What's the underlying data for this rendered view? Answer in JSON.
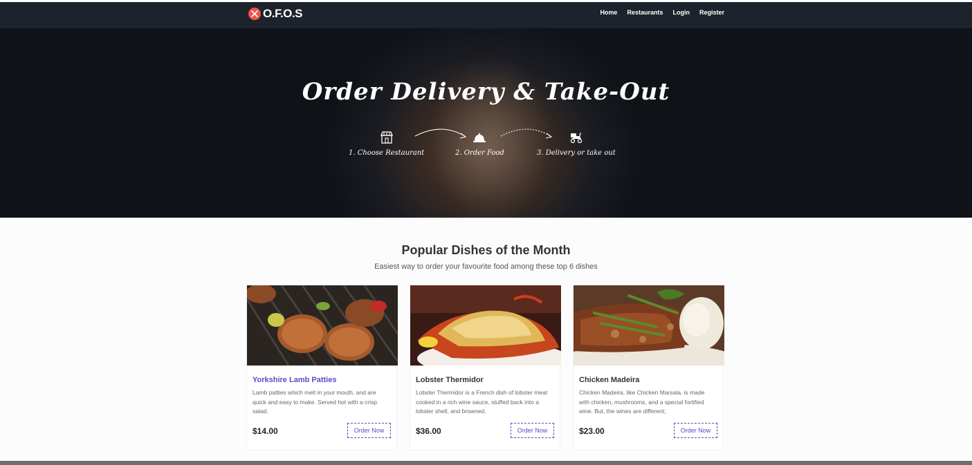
{
  "brand": {
    "name": "O.F.O.S",
    "accent": "#f0554b"
  },
  "nav": {
    "items": [
      {
        "label": "Home"
      },
      {
        "label": "Restaurants"
      },
      {
        "label": "Login"
      },
      {
        "label": "Register"
      }
    ]
  },
  "hero": {
    "title": "Order Delivery & Take-Out",
    "steps": [
      {
        "label": "1. Choose Restaurant",
        "icon": "restaurant-icon"
      },
      {
        "label": "2. Order Food",
        "icon": "cloche-icon"
      },
      {
        "label": "3. Delivery or take out",
        "icon": "delivery-scooter-icon"
      }
    ]
  },
  "popular": {
    "title": "Popular Dishes of the Month",
    "subtitle": "Easiest way to order your favourite food among these top 6 dishes",
    "order_label": "Order Now",
    "dishes": [
      {
        "name": "Yorkshire Lamb Patties",
        "description": "Lamb patties which melt in your mouth, and are quick and easy to make. Served hot with a crisp salad.",
        "price": "$14.00"
      },
      {
        "name": "Lobster Thermidor",
        "description": "Lobster Thermidor is a French dish of lobster meat cooked in a rich wine sauce, stuffed back into a lobster shell, and browned.",
        "price": "$36.00"
      },
      {
        "name": "Chicken Madeira",
        "description": "Chicken Madeira, like Chicken Marsala, is made with chicken, mushrooms, and a special fortified wine. But, the wines are different;",
        "price": "$23.00"
      }
    ]
  },
  "colors": {
    "nav_bg": "#1d232c",
    "primary": "#5b48c4"
  }
}
